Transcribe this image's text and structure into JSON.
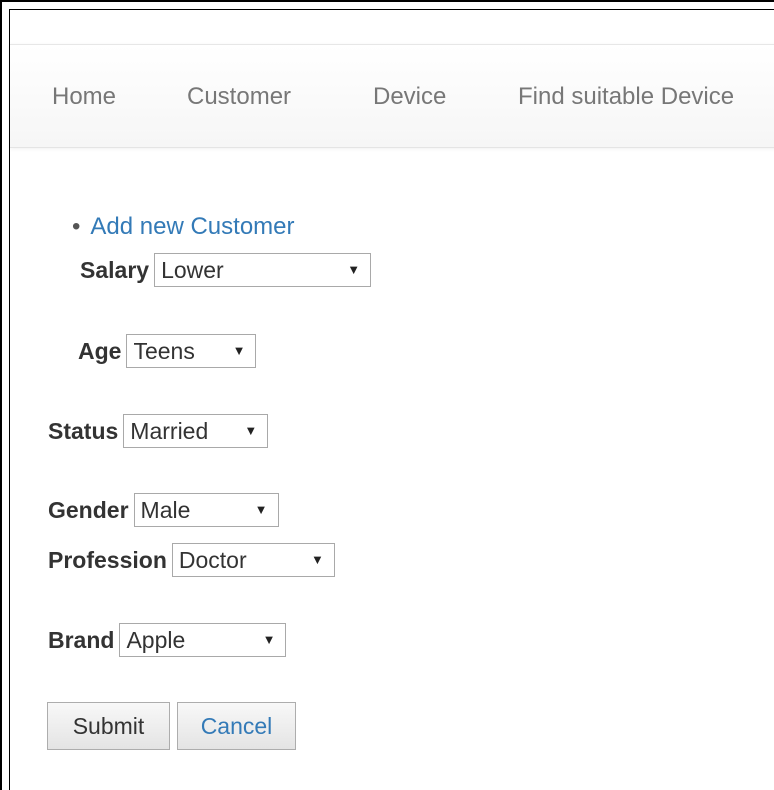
{
  "nav": {
    "items": [
      {
        "label": "Home"
      },
      {
        "label": "Customer"
      },
      {
        "label": "Device"
      },
      {
        "label": "Find suitable Device"
      }
    ]
  },
  "links": {
    "add_customer": "Add new Customer"
  },
  "form": {
    "salary": {
      "label": "Salary",
      "value": "Lower"
    },
    "age": {
      "label": "Age",
      "value": "Teens"
    },
    "status": {
      "label": "Status",
      "value": "Married"
    },
    "gender": {
      "label": "Gender",
      "value": "Male"
    },
    "profession": {
      "label": "Profession",
      "value": "Doctor"
    },
    "brand": {
      "label": "Brand",
      "value": "Apple"
    }
  },
  "buttons": {
    "submit": "Submit",
    "cancel": "Cancel"
  },
  "icons": {
    "dropdown": "chevron-down-icon"
  },
  "colors": {
    "link": "#337ab7",
    "nav_text": "#777777"
  }
}
